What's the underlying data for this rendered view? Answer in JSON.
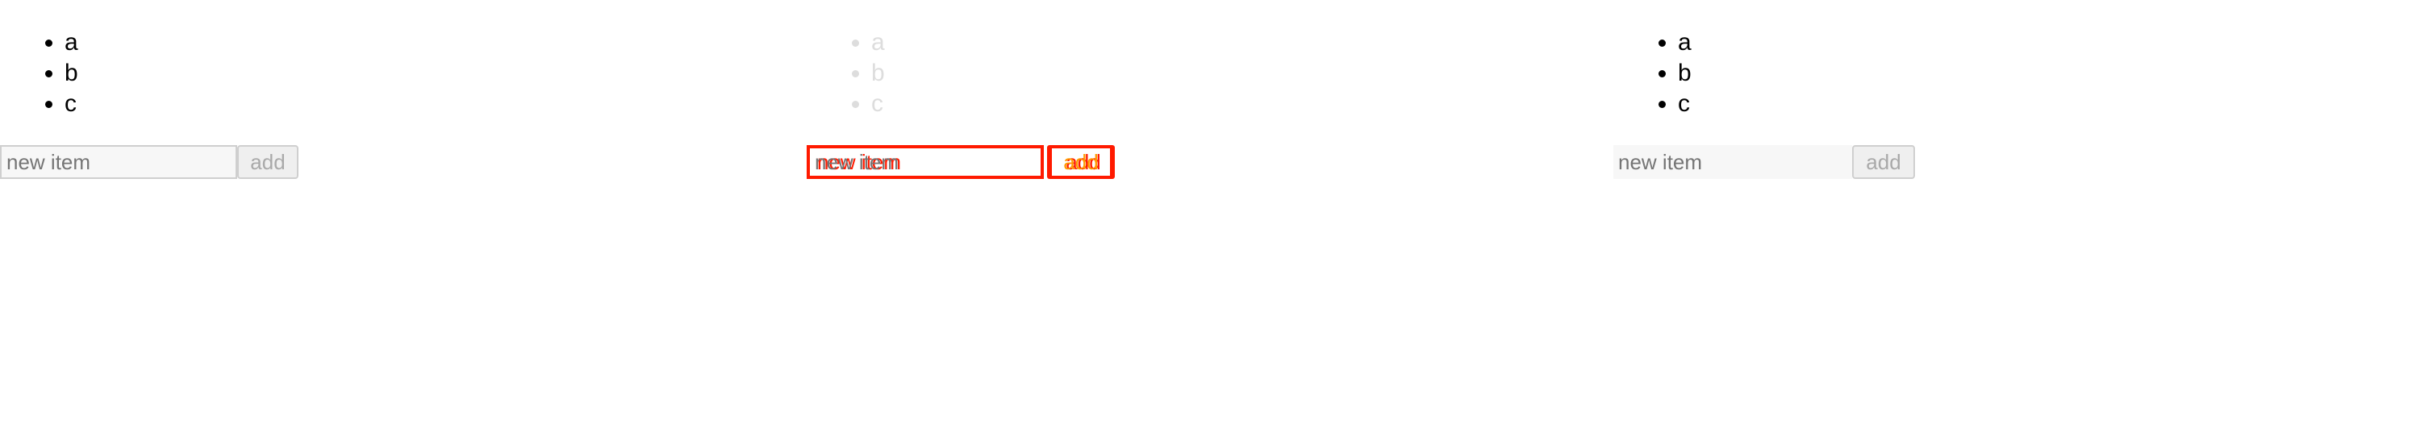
{
  "panels": [
    {
      "items": [
        "a",
        "b",
        "c"
      ],
      "input": {
        "value": "",
        "placeholder": "new item"
      },
      "add_label": "add"
    },
    {
      "items": [
        "a",
        "b",
        "c"
      ],
      "input": {
        "value": "",
        "placeholder": "new item"
      },
      "add_label": "add"
    },
    {
      "items": [
        "a",
        "b",
        "c"
      ],
      "input": {
        "value": "",
        "placeholder": "new item"
      },
      "add_label": "add"
    }
  ],
  "colors": {
    "diff_border": "#ff1a00",
    "diff_text": "#ff7a00",
    "faded_text": "#dddddd"
  }
}
